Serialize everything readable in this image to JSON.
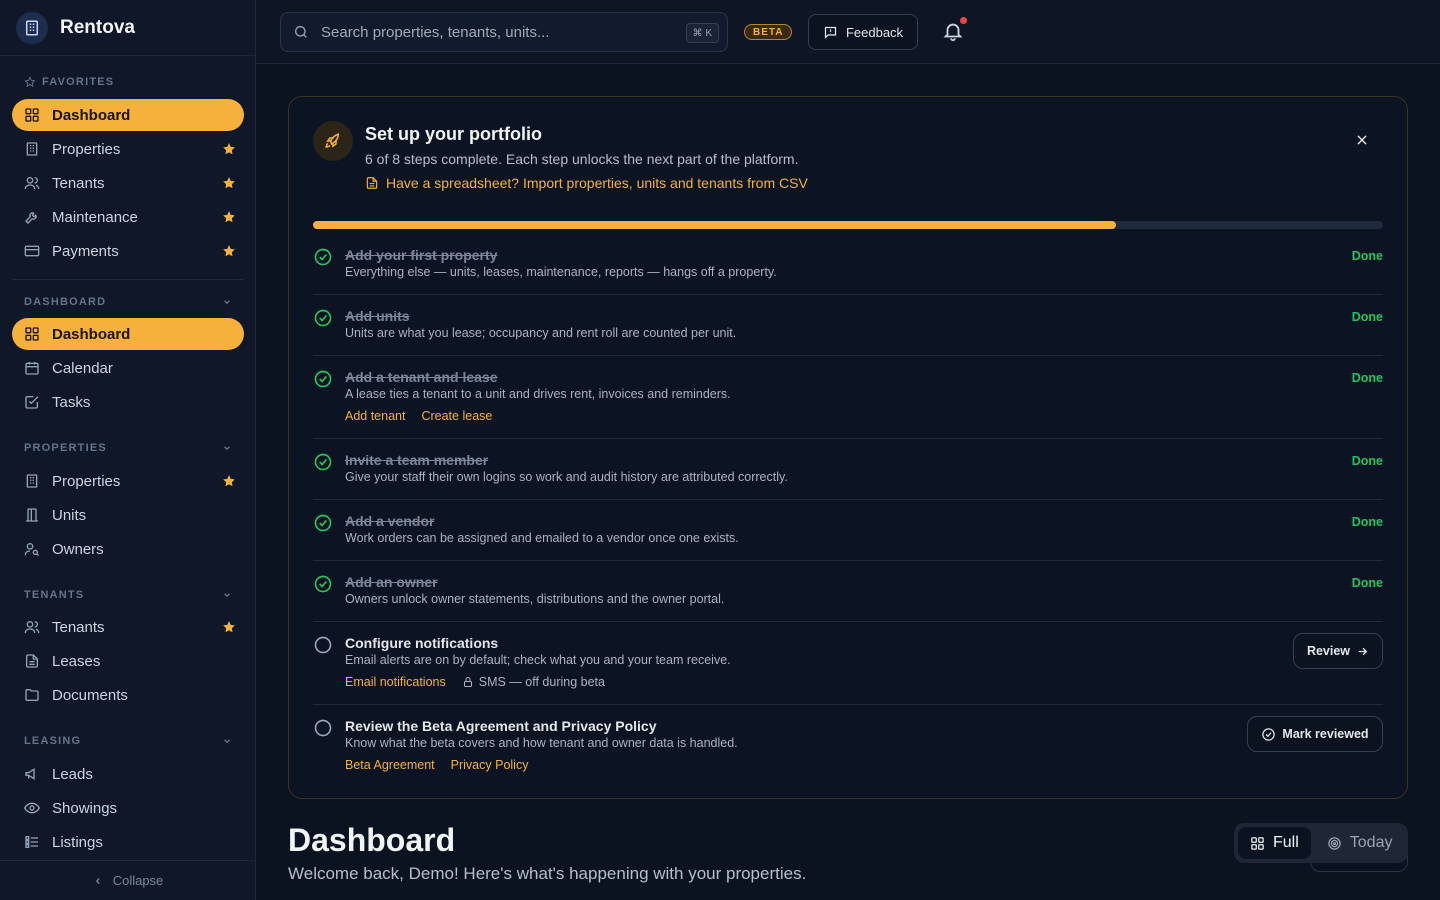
{
  "app": {
    "name": "Rentova"
  },
  "search": {
    "placeholder": "Search properties, tenants, units...",
    "shortcut": "⌘ K"
  },
  "topbar": {
    "beta_label": "BETA",
    "feedback_label": "Feedback"
  },
  "sidebar": {
    "favorites_title": "FAVORITES",
    "favorites": [
      {
        "label": "Dashboard",
        "icon": "grid-icon",
        "active": true,
        "starred": false
      },
      {
        "label": "Properties",
        "icon": "building-icon",
        "active": false,
        "starred": true
      },
      {
        "label": "Tenants",
        "icon": "users-icon",
        "active": false,
        "starred": true
      },
      {
        "label": "Maintenance",
        "icon": "wrench-icon",
        "active": false,
        "starred": true
      },
      {
        "label": "Payments",
        "icon": "credit-card-icon",
        "active": false,
        "starred": true
      }
    ],
    "dashboard_title": "DASHBOARD",
    "dashboard": [
      {
        "label": "Dashboard",
        "icon": "grid-icon",
        "active": true
      },
      {
        "label": "Calendar",
        "icon": "calendar-icon",
        "active": false
      },
      {
        "label": "Tasks",
        "icon": "checkbox-icon",
        "active": false
      }
    ],
    "properties_title": "PROPERTIES",
    "properties": [
      {
        "label": "Properties",
        "icon": "building-icon",
        "starred": true
      },
      {
        "label": "Units",
        "icon": "door-icon",
        "starred": false
      },
      {
        "label": "Owners",
        "icon": "user-key-icon",
        "starred": false
      }
    ],
    "tenants_title": "TENANTS",
    "tenants": [
      {
        "label": "Tenants",
        "icon": "users-icon",
        "starred": true
      },
      {
        "label": "Leases",
        "icon": "document-icon",
        "starred": false
      },
      {
        "label": "Documents",
        "icon": "folder-icon",
        "starred": false
      }
    ],
    "leasing_title": "LEASING",
    "leasing": [
      {
        "label": "Leads",
        "icon": "megaphone-icon"
      },
      {
        "label": "Showings",
        "icon": "eye-icon"
      },
      {
        "label": "Listings",
        "icon": "list-icon"
      }
    ],
    "collapse_label": "Collapse"
  },
  "setup": {
    "title": "Set up your portfolio",
    "subtitle": "6 of 8 steps complete. Each step unlocks the next part of the platform.",
    "import_link": "Have a spreadsheet? Import properties, units and tenants from CSV",
    "progress": 0.75,
    "done_label": "Done",
    "steps": [
      {
        "title": "Add your first property",
        "desc": "Everything else — units, leases, maintenance, reports — hangs off a property.",
        "done": true
      },
      {
        "title": "Add units",
        "desc": "Units are what you lease; occupancy and rent roll are counted per unit.",
        "done": true
      },
      {
        "title": "Add a tenant and lease",
        "desc": "A lease ties a tenant to a unit and drives rent, invoices and reminders.",
        "done": true,
        "link1": "Add tenant",
        "link2": "Create lease"
      },
      {
        "title": "Invite a team member",
        "desc": "Give your staff their own logins so work and audit history are attributed correctly.",
        "done": true
      },
      {
        "title": "Add a vendor",
        "desc": "Work orders can be assigned and emailed to a vendor once one exists.",
        "done": true
      },
      {
        "title": "Add an owner",
        "desc": "Owners unlock owner statements, distributions and the owner portal.",
        "done": true
      },
      {
        "title": "Configure notifications",
        "desc": "Email alerts are on by default; check what you and your team receive.",
        "done": false,
        "link1": "Email notifications",
        "muted": "SMS — off during beta",
        "action": "Review"
      },
      {
        "title": "Review the Beta Agreement and Privacy Policy",
        "desc": "Know what the beta covers and how tenant and owner data is handled.",
        "done": false,
        "link1": "Beta Agreement",
        "link2": "Privacy Policy",
        "action": "Mark reviewed"
      }
    ]
  },
  "dashboard": {
    "title": "Dashboard",
    "subtitle": "Welcome back, Demo! Here's what's happening with your properties.",
    "view_full": "Full",
    "view_today": "Today"
  },
  "colors": {
    "accent": "#f6b13c",
    "success": "#22c55e",
    "background": "#0b1220"
  }
}
